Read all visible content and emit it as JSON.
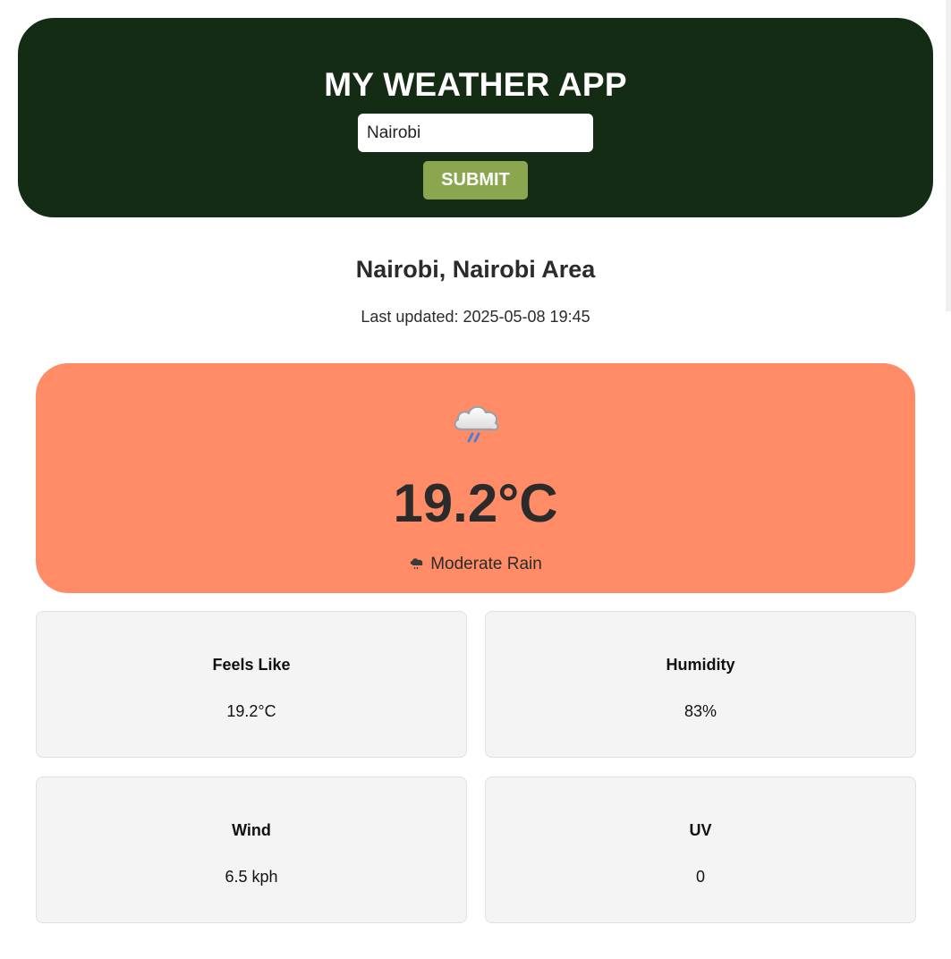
{
  "header": {
    "title": "MY WEATHER APP",
    "search_value": "Nairobi",
    "search_placeholder": "",
    "submit_label": "SUBMIT",
    "background_color": "#142b14",
    "button_color": "#8aa64f"
  },
  "location": {
    "name": "Nairobi, Nairobi Area",
    "last_updated": "Last updated: 2025-05-08 19:45"
  },
  "current": {
    "icon": "cloud-rain-icon",
    "temperature": "19.2°C",
    "condition": "Moderate Rain",
    "card_color": "#ff8c66"
  },
  "stats": [
    {
      "label": "Feels Like",
      "value": "19.2°C"
    },
    {
      "label": "Humidity",
      "value": "83%"
    },
    {
      "label": "Wind",
      "value": "6.5 kph"
    },
    {
      "label": "UV",
      "value": "0"
    }
  ]
}
